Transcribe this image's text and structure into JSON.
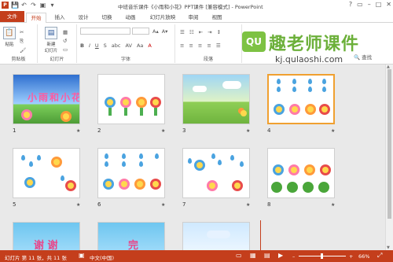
{
  "window": {
    "title": "中班音乐课件《小雨和小花》PPT课件 [兼容模式] - PowerPoint",
    "app_icon_label": "P",
    "controls": [
      "?",
      "▭",
      "–",
      "□",
      "✕"
    ]
  },
  "quick_access": [
    "💾",
    "↶",
    "↷",
    "▣",
    "▾"
  ],
  "tabs": [
    "文件",
    "开始",
    "插入",
    "设计",
    "切换",
    "动画",
    "幻灯片放映",
    "审阅",
    "视图"
  ],
  "active_tab": "开始",
  "ribbon": {
    "groups": {
      "clipboard": "剪贴板",
      "slides": "幻灯片",
      "font": "字体",
      "paragraph": "段落"
    },
    "paste_label": "粘贴",
    "new_slide_label": "新建\n幻灯片",
    "font_buttons": [
      "B",
      "I",
      "U",
      "S",
      "abc",
      "AV",
      "Aa",
      "A"
    ],
    "para_buttons": [
      "≡",
      "≡",
      "≡",
      "≡",
      "☰"
    ],
    "find_label": "🔍 查找"
  },
  "watermark": {
    "badge": "QU",
    "title": "趣老师课件",
    "url": "kj.qulaoshi.com"
  },
  "slides": [
    {
      "num": "1",
      "title": "小雨和小花"
    },
    {
      "num": "2"
    },
    {
      "num": "3"
    },
    {
      "num": "4"
    },
    {
      "num": "5"
    },
    {
      "num": "6"
    },
    {
      "num": "7"
    },
    {
      "num": "8"
    },
    {
      "num": "",
      "title": "谢 谢"
    },
    {
      "num": "",
      "title": "完"
    },
    {
      "num": ""
    }
  ],
  "star_icon": "★",
  "status": {
    "slide_info": "幻灯片 第 11 张，共 11 张",
    "language": "中文(中国)",
    "zoom": "66%",
    "zoom_minus": "–",
    "zoom_plus": "+"
  },
  "colors": {
    "accent": "#c43e1c",
    "selected_border": "#f0a030"
  }
}
